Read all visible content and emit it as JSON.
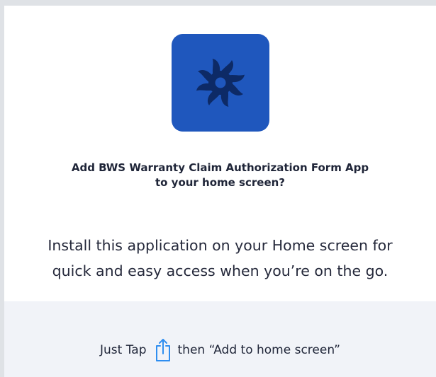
{
  "app": {
    "icon_name": "pinwheel-logo-icon",
    "icon_color": "#1f57bd"
  },
  "prompt": {
    "title_line1": "Add BWS Warranty Claim Authorization Form App",
    "title_line2": "to your home screen?",
    "body_line1": "Install this application on your Home screen for",
    "body_line2": "quick and easy access when you’re on the go."
  },
  "footer": {
    "before_icon": "Just Tap",
    "share_icon": "share-icon",
    "after_icon": "then “Add to home screen”",
    "share_icon_color": "#2f8ef0"
  }
}
